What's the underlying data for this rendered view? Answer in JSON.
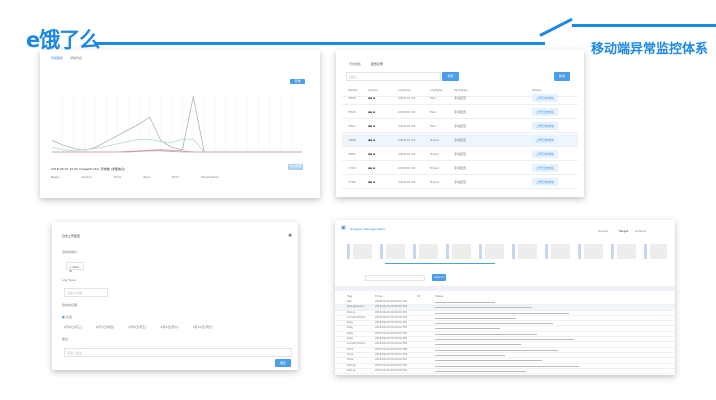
{
  "header": {
    "logo": "e饿了么",
    "title": "移动端异常监控体系"
  },
  "panel1": {
    "tabs": [
      "异常趋势",
      "详情列表"
    ],
    "button": "查询",
    "detail_title": "2018-06-07 15:00 ImageMonitor 异常数 (详细信息)",
    "export": "导出数据",
    "table_headers": [
      "Begin",
      "Device",
      "Time",
      "Type",
      "Error",
      "Parameters"
    ],
    "chart_data": {
      "type": "line",
      "x": [
        0,
        1,
        2,
        3,
        4,
        5,
        6,
        7,
        8,
        9,
        10,
        11,
        12,
        13,
        14,
        15,
        16,
        17,
        18,
        19,
        20,
        21,
        22,
        23
      ],
      "ylim": [
        0,
        500
      ],
      "grid": true,
      "series": [
        {
          "color": "#a8b8b0",
          "values": [
            100,
            60,
            30,
            15,
            40,
            90,
            140,
            190,
            240,
            300,
            100,
            40,
            20,
            480,
            0,
            0,
            0,
            0,
            0,
            0,
            0,
            0,
            0,
            0
          ]
        },
        {
          "color": "#b8d8c8",
          "values": [
            40,
            20,
            10,
            20,
            30,
            50,
            70,
            90,
            110,
            110,
            90,
            80,
            110,
            110,
            0,
            0,
            0,
            0,
            0,
            0,
            0,
            0,
            0,
            0
          ]
        },
        {
          "color": "#d89090",
          "values": [
            0,
            0,
            0,
            0,
            0,
            0,
            0,
            5,
            10,
            15,
            20,
            15,
            10,
            0,
            0,
            0,
            0,
            0,
            0,
            0,
            0,
            0,
            0,
            0
          ]
        },
        {
          "color": "#c0a0c8",
          "values": [
            0,
            0,
            0,
            0,
            0,
            0,
            0,
            0,
            5,
            10,
            10,
            5,
            0,
            0,
            0,
            0,
            0,
            0,
            0,
            0,
            0,
            0,
            0,
            0
          ]
        }
      ]
    }
  },
  "panel2": {
    "tabs": [
      "异常收集",
      "配置记录"
    ],
    "search_placeholder": "请输入",
    "search": "搜索",
    "add": "新增",
    "headers": [
      "TaskId",
      "Userld",
      "LogTime",
      "LogType",
      "TaskType",
      "Status"
    ],
    "rows": [
      [
        "7833",
        "2018-07-22",
        "Taro",
        "手动配置",
        "上传日志成功"
      ],
      [
        "7825",
        "2018-07-22",
        "Taro",
        "手动配置",
        "上传日志成功"
      ],
      [
        "7817",
        "2018-07-22",
        "Taro",
        "手动配置",
        "上传日志成功"
      ],
      [
        "7809",
        "2018-07-22",
        "Trojan",
        "手动配置",
        "上传日志成功"
      ],
      [
        "7801",
        "2018-07-22",
        "Trojan",
        "手动配置",
        "上传日志成功"
      ],
      [
        "7793",
        "2018-07-22",
        "Trojan",
        "手动配置",
        "上传日志成功"
      ],
      [
        "7785",
        "2018-07-22",
        "Trojan",
        "手动配置",
        "上传日志成功"
      ]
    ]
  },
  "panel3": {
    "title": "日志上传配置",
    "label_user": "选中的用户:",
    "user_tag": "+ New ID",
    "label_type": "Log Type:",
    "type_placeholder": "请输入内容",
    "label_date": "选中的日期:",
    "select_all": "全选",
    "dates": [
      "6月6日(周三)",
      "6月7日(周四)",
      "6月8日(周五)",
      "6月9日(周六)",
      "6月10日(周日)"
    ],
    "label_note": "备注:",
    "note_placeholder": "请输入备注",
    "submit": "确定"
  },
  "panel4": {
    "app": "Dragger DebuggingBox",
    "tabs": [
      "Source",
      "Target",
      "Actions"
    ],
    "search": "Search",
    "headers": [
      "Tag",
      "Time",
      "Id",
      "Value"
    ],
    "rows": [
      [
        "Dsp",
        "2018-06-24 09:00:00.330"
      ],
      [
        "DebugSession",
        "2018-06-24 09:00:00.332"
      ],
      [
        "Daring",
        "2018-06-24 09:00:00.333"
      ],
      [
        "LocationCheck",
        "2018-06-24 09:00:00.333"
      ],
      [
        "Diag",
        "2018-06-24 09:00:00.335"
      ],
      [
        "Diag",
        "2018-06-24 09:00:00.335"
      ],
      [
        "Diag",
        "2018-06-24 09:00:00.335"
      ],
      [
        "Diag",
        "2018-06-24 09:00:00.335"
      ],
      [
        "LocationCheck",
        "2018-06-24 09:00:00.336"
      ],
      [
        "Tools",
        "2018-06-24 09:00:00.338"
      ],
      [
        "Tools",
        "2018-06-24 09:00:00.339"
      ],
      [
        "Tools",
        "2018-06-24 09:00:00.341"
      ],
      [
        "Daring",
        "2018-06-24 09:00:00.342"
      ],
      [
        "Daring",
        "2018-06-24 09:00:00.342"
      ]
    ]
  }
}
